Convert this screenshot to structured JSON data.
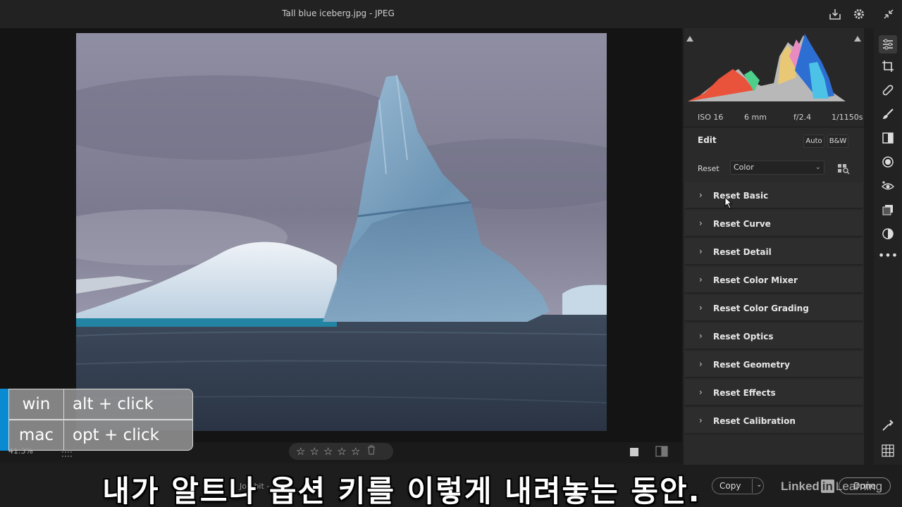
{
  "window": {
    "title": "Tall blue iceberg.jpg  -  JPEG"
  },
  "exif": {
    "iso": "ISO 16",
    "focal": "6 mm",
    "aperture": "f/2.4",
    "shutter": "1/1150s"
  },
  "edit": {
    "title": "Edit",
    "auto_label": "Auto",
    "bw_label": "B&W",
    "reset_label": "Reset",
    "profile_value": "Color"
  },
  "sections": [
    {
      "label": "Reset Basic"
    },
    {
      "label": "Reset Curve"
    },
    {
      "label": "Reset Detail"
    },
    {
      "label": "Reset Color Mixer"
    },
    {
      "label": "Reset Color Grading"
    },
    {
      "label": "Reset Optics"
    },
    {
      "label": "Reset Geometry"
    },
    {
      "label": "Reset Effects"
    },
    {
      "label": "Reset Calibration"
    }
  ],
  "bottom": {
    "zoom": "41.3%",
    "stars": [
      "☆",
      "☆",
      "☆",
      "☆",
      "☆"
    ],
    "copy_label": "Copy",
    "done_label": "Done",
    "under_text": "Job    bit -    MP)"
  },
  "shortcut": {
    "win_key": "win",
    "win_action": "alt + click",
    "mac_key": "mac",
    "mac_action": "opt + click"
  },
  "watermark": {
    "linked": "Linked",
    "in": "in",
    "learning": "Learning"
  },
  "subtitle": "내가 알트나 옵션 키를 이렇게 내려놓는 동안.",
  "colors": {
    "accent": "#0a8bd1",
    "panel": "#2a2a2a",
    "section": "#2d2d2d"
  },
  "icons": {
    "top": [
      "export-icon",
      "gear-icon",
      "collapse-icon"
    ],
    "tools": [
      "sliders-icon",
      "crop-icon",
      "healing-icon",
      "brush-icon",
      "gradient-icon",
      "radial-icon",
      "redeye-icon",
      "layers-icon",
      "presets-icon",
      "more-icon",
      "eyedropper-icon",
      "grid-icon"
    ]
  }
}
